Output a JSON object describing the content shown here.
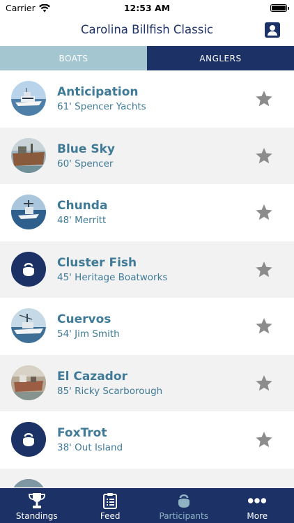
{
  "status_bar": {
    "carrier": "Carrier",
    "time": "12:53 AM"
  },
  "header": {
    "title": "Carolina Billfish Classic"
  },
  "tabs": [
    {
      "label": "BOATS",
      "selected": true
    },
    {
      "label": "ANGLERS",
      "selected": false
    }
  ],
  "boats": [
    {
      "name": "Anticipation",
      "description": "61' Spencer Yachts",
      "photo": "boat-photo",
      "favorited": false
    },
    {
      "name": "Blue Sky",
      "description": "60' Spencer",
      "photo": "boat-photo",
      "favorited": false
    },
    {
      "name": "Chunda",
      "description": "48' Merritt",
      "photo": "boat-photo",
      "favorited": false
    },
    {
      "name": "Cluster Fish",
      "description": "45' Heritage Boatworks",
      "photo": "kettlebell-placeholder-icon",
      "favorited": false
    },
    {
      "name": "Cuervos",
      "description": "54' Jim Smith",
      "photo": "boat-photo",
      "favorited": false
    },
    {
      "name": "El Cazador",
      "description": "85' Ricky Scarborough",
      "photo": "boat-photo",
      "favorited": false
    },
    {
      "name": "FoxTrot",
      "description": "38' Out Island",
      "photo": "kettlebell-placeholder-icon",
      "favorited": false
    }
  ],
  "tab_bar": [
    {
      "label": "Standings",
      "icon": "trophy-icon",
      "active": false
    },
    {
      "label": "Feed",
      "icon": "clipboard-icon",
      "active": false
    },
    {
      "label": "Participants",
      "icon": "kettlebell-icon",
      "active": true
    },
    {
      "label": "More",
      "icon": "more-dots-icon",
      "active": false
    }
  ],
  "colors": {
    "primary": "#1c3166",
    "accent": "#3f7a97",
    "tab_inactive_bg": "#a3c6d1",
    "star": "#8c8c8c",
    "alt_row": "#f2f2f2"
  }
}
